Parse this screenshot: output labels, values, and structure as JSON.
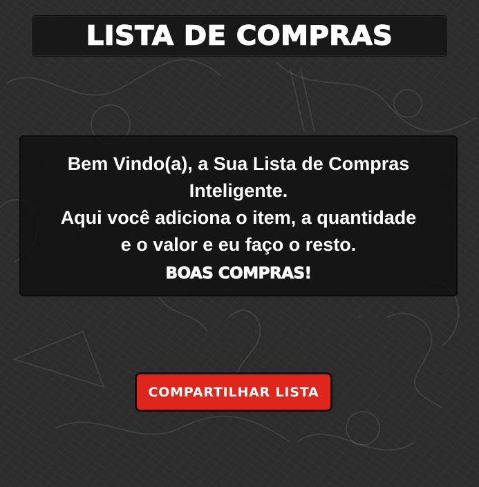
{
  "header": {
    "title": "LISTA DE COMPRAS"
  },
  "welcome": {
    "line1": "Bem Vindo(a), a Sua Lista de Compras",
    "line2": "Inteligente.",
    "line3": "Aqui você adiciona o item, a quantidade",
    "line4": "e o valor e eu faço o resto.",
    "closing": "BOAS COMPRAS!"
  },
  "actions": {
    "share_label": "COMPARTILHAR LISTA"
  },
  "colors": {
    "background": "#2c2c2c",
    "panel": "#121212",
    "share_button": "#e0261c",
    "text": "#ffffff"
  }
}
